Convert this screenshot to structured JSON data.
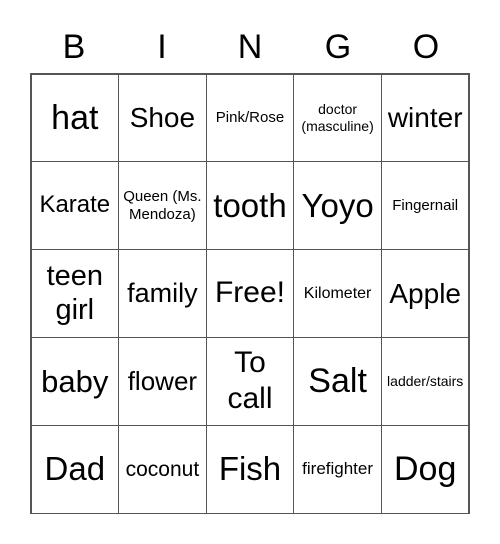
{
  "header": {
    "letters": [
      "B",
      "I",
      "N",
      "G",
      "O"
    ]
  },
  "cells": [
    "hat",
    "Shoe",
    "Pink/Rose",
    "doctor (masculine)",
    "winter",
    "Karate",
    "Queen (Ms. Mendoza)",
    "tooth",
    "Yoyo",
    "Fingernail",
    "teen girl",
    "family",
    "Free!",
    "Kilometer",
    "Apple",
    "baby",
    "flower",
    "To call",
    "Salt",
    "ladder/stairs",
    "Dad",
    "coconut",
    "Fish",
    "firefighter",
    "Dog"
  ]
}
